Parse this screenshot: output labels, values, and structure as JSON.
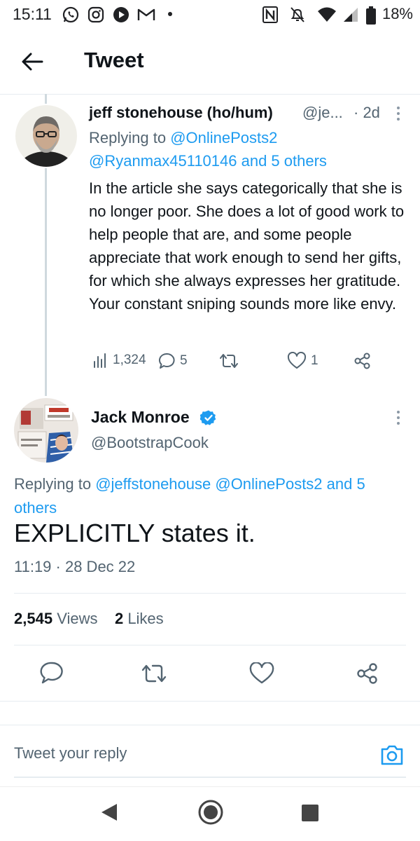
{
  "status_bar": {
    "time": "15:11",
    "battery": "18%",
    "icons": [
      "whatsapp-icon",
      "instagram-icon",
      "play-icon",
      "gmail-icon",
      "dot-icon",
      "nfc-icon",
      "mute-icon",
      "wifi-icon",
      "signal-icon",
      "battery-icon"
    ]
  },
  "header": {
    "title": "Tweet"
  },
  "reply_tweet": {
    "name": "jeff stonehouse (ho/hum)",
    "handle": "@je...",
    "time": "· 2d",
    "replying_prefix": "Replying to",
    "replying_to_1": "@OnlinePosts2",
    "replying_to_2": "@Ryanmax45110146 and 5 others",
    "text": "In the article she says categorically that she is no longer poor. She does a lot of good work to help people that are, and some people appreciate that work enough to send her gifts, for which she always expresses her gratitude. Your constant sniping sounds more like envy.",
    "views": "1,324",
    "replies": "5",
    "retweets": "",
    "likes": "1"
  },
  "main_tweet": {
    "name": "Jack Monroe",
    "handle": "@BootstrapCook",
    "replying_prefix": "Replying to",
    "replying_to": "@jeffstonehouse @OnlinePosts2 and 5 others",
    "text": "EXPLICITLY states it.",
    "timestamp": "11:19 · 28 Dec 22",
    "views_count": "2,545",
    "views_label": "Views",
    "likes_count": "2",
    "likes_label": "Likes"
  },
  "composer": {
    "placeholder": "Tweet your reply"
  },
  "colors": {
    "accent": "#1d9bf0",
    "text": "#0f1419",
    "secondary": "#536471"
  }
}
